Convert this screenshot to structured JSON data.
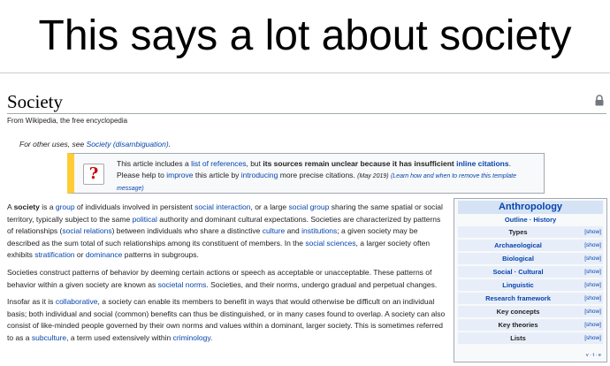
{
  "meme": {
    "caption": "This says a lot about society"
  },
  "article": {
    "title": "Society",
    "tagline": "From Wikipedia, the free encyclopedia",
    "hatnote": {
      "prefix": "For other uses, see ",
      "link": "Society (disambiguation)",
      "suffix": "."
    }
  },
  "ambox": {
    "line1_a": "This article includes a ",
    "line1_link": "list of references",
    "line1_b": ", but ",
    "line1_bold": "its sources remain unclear because it has insufficient ",
    "line1_bold_link": "inline citations",
    "line1_end": ".",
    "line2_a": "Please help to ",
    "line2_link1": "improve",
    "line2_b": " this article by ",
    "line2_link2": "introducing",
    "line2_c": " more precise citations.",
    "date": "(May 2019)",
    "learn": "(Learn how and when to remove this template message)"
  },
  "body": {
    "p1": [
      {
        "t": "A "
      },
      {
        "t": "society",
        "b": true
      },
      {
        "t": " is a "
      },
      {
        "t": "group",
        "l": true
      },
      {
        "t": " of individuals involved in persistent "
      },
      {
        "t": "social interaction",
        "l": true
      },
      {
        "t": ", or a large "
      },
      {
        "t": "social group",
        "l": true
      },
      {
        "t": " sharing the same spatial or social territory, typically subject to the same "
      },
      {
        "t": "political",
        "l": true
      },
      {
        "t": " authority and dominant cultural expectations. Societies are characterized by patterns of relationships ("
      },
      {
        "t": "social relations",
        "l": true
      },
      {
        "t": ") between individuals who share a distinctive "
      },
      {
        "t": "culture",
        "l": true
      },
      {
        "t": " and "
      },
      {
        "t": "institutions",
        "l": true
      },
      {
        "t": "; a given society may be described as the sum total of such relationships among its constituent of members. In the "
      },
      {
        "t": "social sciences",
        "l": true
      },
      {
        "t": ", a larger society often exhibits "
      },
      {
        "t": "stratification",
        "l": true
      },
      {
        "t": " or "
      },
      {
        "t": "dominance",
        "l": true
      },
      {
        "t": " patterns in subgroups."
      }
    ],
    "p2": [
      {
        "t": "Societies construct patterns of behavior by deeming certain actions or speech as acceptable or unacceptable. These patterns of behavior within a given society are known as "
      },
      {
        "t": "societal norms",
        "l": true
      },
      {
        "t": ". Societies, and their norms, undergo gradual and perpetual changes."
      }
    ],
    "p3": [
      {
        "t": "Insofar as it is "
      },
      {
        "t": "collaborative",
        "l": true
      },
      {
        "t": ", a society can enable its members to benefit in ways that would otherwise be difficult on an individual basis; both individual and social (common) benefits can thus be distinguished, or in many cases found to overlap. A society can also consist of like-minded people governed by their own norms and values within a dominant, larger society. This is sometimes referred to as a "
      },
      {
        "t": "subculture",
        "l": true
      },
      {
        "t": ", a term used extensively within "
      },
      {
        "t": "criminology",
        "l": true
      },
      {
        "t": "."
      }
    ]
  },
  "navbox": {
    "title": "Anthropology",
    "links": "Outline · History",
    "rows": [
      {
        "label": "Types",
        "link": false,
        "show": "[show]"
      },
      {
        "label": "Archaeological",
        "link": true,
        "show": "[show]"
      },
      {
        "label": "Biological",
        "link": true,
        "show": "[show]"
      },
      {
        "label": "Social · Cultural",
        "link": true,
        "show": "[show]"
      },
      {
        "label": "Linguistic",
        "link": true,
        "show": "[show]"
      },
      {
        "label": "Research framework",
        "link": true,
        "show": "[show]"
      },
      {
        "label": "Key concepts",
        "link": false,
        "show": "[show]"
      },
      {
        "label": "Key theories",
        "link": false,
        "show": "[show]"
      },
      {
        "label": "Lists",
        "link": false,
        "show": "[show]"
      }
    ],
    "vte": "v · t · e"
  },
  "colors": {
    "link": "#0645ad",
    "ambox_stripe": "#ffcc33",
    "navbox_header": "#d6e3f5"
  }
}
